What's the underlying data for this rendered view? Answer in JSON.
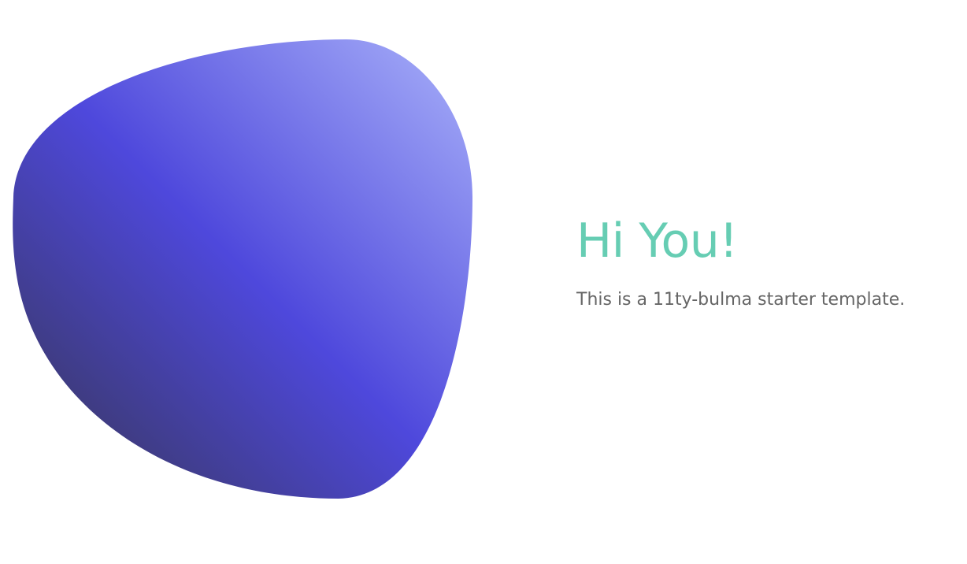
{
  "hero": {
    "title": "Hi You!",
    "subtitle": "This is a 11ty-bulma starter template."
  },
  "blob": {
    "icon": "gradient-blob-illustration",
    "gradient_colors": [
      "#3a3866",
      "#4e48dc",
      "#9ba1f5"
    ]
  },
  "colors": {
    "title": "#66cdb3",
    "subtitle": "#666666",
    "background": "#ffffff"
  }
}
